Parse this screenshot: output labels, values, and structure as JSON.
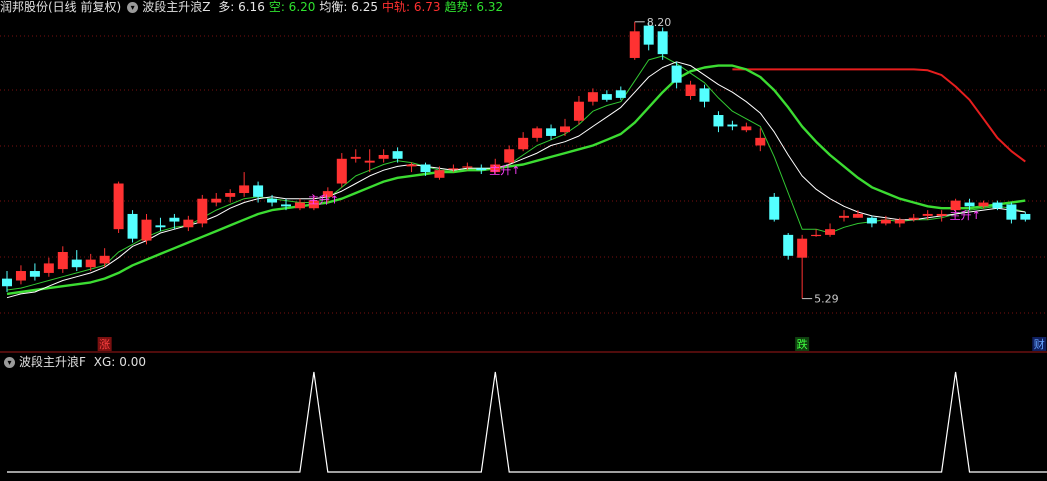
{
  "main_header": {
    "stock": "润邦股份(日线 前复权)",
    "indicator": "波段主升浪Z",
    "items": [
      {
        "label": "多:",
        "value": "6.16",
        "color": "#e6e6e6"
      },
      {
        "label": "空:",
        "value": "6.20",
        "color": "#2fe12f"
      },
      {
        "label": "均衡:",
        "value": "6.25",
        "color": "#e6e6e6"
      },
      {
        "label": "中轨:",
        "value": "6.73",
        "color": "#ff3030"
      },
      {
        "label": "趋势:",
        "value": "6.32",
        "color": "#2fe12f"
      }
    ]
  },
  "sub_header": {
    "indicator": "波段主升浪F",
    "label": "XG:",
    "value": "0.00"
  },
  "icons": {
    "dropdown": "chevron-down-icon"
  },
  "colors": {
    "up": "#ff3232",
    "down": "#54ffff",
    "trend": "#3cdc32",
    "duo": "#ffffff",
    "kong": "#32c832",
    "zhonggui": "#e61e1e",
    "signal": "#ff40ff",
    "grid": "#7a1010"
  },
  "chart_data": {
    "type": "candlestick",
    "price_axis": {
      "min": 4.96,
      "max": 8.24
    },
    "candles": [
      [
        5.5,
        5.42,
        5.58,
        5.36
      ],
      [
        5.48,
        5.58,
        5.64,
        5.44
      ],
      [
        5.58,
        5.52,
        5.66,
        5.48
      ],
      [
        5.56,
        5.66,
        5.72,
        5.52
      ],
      [
        5.6,
        5.78,
        5.84,
        5.56
      ],
      [
        5.7,
        5.62,
        5.8,
        5.58
      ],
      [
        5.62,
        5.7,
        5.76,
        5.58
      ],
      [
        5.66,
        5.74,
        5.82,
        5.62
      ],
      [
        6.02,
        6.5,
        6.52,
        5.98
      ],
      [
        6.18,
        5.92,
        6.22,
        5.88
      ],
      [
        5.9,
        6.12,
        6.18,
        5.86
      ],
      [
        6.06,
        6.04,
        6.14,
        6.0
      ],
      [
        6.14,
        6.1,
        6.18,
        6.02
      ],
      [
        6.04,
        6.12,
        6.16,
        6.0
      ],
      [
        6.08,
        6.34,
        6.38,
        6.04
      ],
      [
        6.3,
        6.34,
        6.4,
        6.26
      ],
      [
        6.36,
        6.4,
        6.44,
        6.3
      ],
      [
        6.4,
        6.48,
        6.62,
        6.36
      ],
      [
        6.48,
        6.36,
        6.52,
        6.3
      ],
      [
        6.34,
        6.3,
        6.38,
        6.26
      ],
      [
        6.28,
        6.26,
        6.34,
        6.22
      ],
      [
        6.24,
        6.3,
        6.34,
        6.22
      ],
      [
        6.24,
        6.32,
        6.38,
        6.22
      ],
      [
        6.36,
        6.42,
        6.46,
        6.3
      ],
      [
        6.5,
        6.76,
        6.82,
        6.46
      ],
      [
        6.76,
        6.78,
        6.86,
        6.72
      ],
      [
        6.72,
        6.74,
        6.86,
        6.62
      ],
      [
        6.76,
        6.8,
        6.86,
        6.72
      ],
      [
        6.84,
        6.76,
        6.88,
        6.72
      ],
      [
        6.68,
        6.7,
        6.72,
        6.62
      ],
      [
        6.7,
        6.62,
        6.72,
        6.58
      ],
      [
        6.56,
        6.64,
        6.68,
        6.54
      ],
      [
        6.66,
        6.66,
        6.7,
        6.62
      ],
      [
        6.68,
        6.68,
        6.72,
        6.64
      ],
      [
        6.66,
        6.64,
        6.7,
        6.6
      ],
      [
        6.62,
        6.7,
        6.76,
        6.6
      ],
      [
        6.72,
        6.86,
        6.9,
        6.7
      ],
      [
        6.86,
        6.98,
        7.04,
        6.84
      ],
      [
        6.98,
        7.08,
        7.1,
        6.94
      ],
      [
        7.08,
        7.0,
        7.12,
        6.96
      ],
      [
        7.04,
        7.1,
        7.18,
        7.0
      ],
      [
        7.16,
        7.36,
        7.42,
        7.12
      ],
      [
        7.36,
        7.46,
        7.5,
        7.32
      ],
      [
        7.44,
        7.38,
        7.48,
        7.36
      ],
      [
        7.48,
        7.4,
        7.52,
        7.38
      ],
      [
        7.82,
        8.1,
        8.2,
        7.8
      ],
      [
        8.16,
        7.96,
        8.2,
        7.9
      ],
      [
        8.1,
        7.86,
        8.14,
        7.8
      ],
      [
        7.74,
        7.56,
        7.78,
        7.5
      ],
      [
        7.42,
        7.54,
        7.58,
        7.38
      ],
      [
        7.5,
        7.36,
        7.54,
        7.3
      ],
      [
        7.22,
        7.1,
        7.26,
        7.04
      ],
      [
        7.12,
        7.1,
        7.16,
        7.06
      ],
      [
        7.06,
        7.1,
        7.14,
        7.04
      ],
      [
        6.9,
        6.98,
        7.08,
        6.84
      ],
      [
        6.36,
        6.12,
        6.4,
        6.1
      ],
      [
        5.96,
        5.74,
        5.98,
        5.7
      ],
      [
        5.72,
        5.92,
        5.96,
        5.29
      ],
      [
        5.96,
        5.96,
        6.02,
        5.94
      ],
      [
        5.96,
        6.02,
        6.08,
        5.94
      ],
      [
        6.14,
        6.16,
        6.22,
        6.1
      ],
      [
        6.14,
        6.18,
        6.22,
        6.14
      ],
      [
        6.14,
        6.08,
        6.16,
        6.04
      ],
      [
        6.08,
        6.12,
        6.16,
        6.06
      ],
      [
        6.08,
        6.12,
        6.14,
        6.04
      ],
      [
        6.12,
        6.14,
        6.18,
        6.1
      ],
      [
        6.16,
        6.18,
        6.22,
        6.12
      ],
      [
        6.16,
        6.18,
        6.22,
        6.1
      ],
      [
        6.22,
        6.32,
        6.34,
        6.2
      ],
      [
        6.3,
        6.26,
        6.34,
        6.22
      ],
      [
        6.26,
        6.3,
        6.32,
        6.24
      ],
      [
        6.3,
        6.24,
        6.32,
        6.22
      ],
      [
        6.28,
        6.12,
        6.3,
        6.08
      ],
      [
        6.18,
        6.12,
        6.2,
        6.1
      ]
    ],
    "ma_lines": {
      "duo": [
        5.3,
        5.34,
        5.36,
        5.42,
        5.48,
        5.52,
        5.56,
        5.62,
        5.72,
        5.84,
        5.9,
        5.98,
        6.02,
        6.06,
        6.1,
        6.16,
        6.24,
        6.3,
        6.34,
        6.36,
        6.34,
        6.34,
        6.34,
        6.36,
        6.42,
        6.5,
        6.58,
        6.64,
        6.68,
        6.7,
        6.68,
        6.66,
        6.64,
        6.66,
        6.66,
        6.66,
        6.7,
        6.76,
        6.82,
        6.9,
        6.94,
        7.0,
        7.1,
        7.2,
        7.3,
        7.46,
        7.62,
        7.72,
        7.78,
        7.74,
        7.64,
        7.54,
        7.46,
        7.36,
        7.24,
        7.04,
        6.8,
        6.58,
        6.44,
        6.34,
        6.26,
        6.2,
        6.16,
        6.14,
        6.12,
        6.12,
        6.14,
        6.16,
        6.18,
        6.2,
        6.22,
        6.24,
        6.22,
        6.2
      ],
      "kong": [
        5.38,
        5.4,
        5.44,
        5.48,
        5.52,
        5.56,
        5.6,
        5.64,
        5.78,
        5.86,
        5.94,
        6.0,
        6.04,
        6.06,
        6.14,
        6.22,
        6.28,
        6.34,
        6.36,
        6.34,
        6.32,
        6.3,
        6.3,
        6.34,
        6.46,
        6.58,
        6.64,
        6.7,
        6.74,
        6.72,
        6.68,
        6.64,
        6.64,
        6.66,
        6.66,
        6.66,
        6.7,
        6.8,
        6.9,
        6.96,
        7.02,
        7.12,
        7.26,
        7.32,
        7.36,
        7.58,
        7.8,
        7.84,
        7.76,
        7.66,
        7.56,
        7.4,
        7.26,
        7.18,
        7.1,
        6.78,
        6.4,
        6.02,
        6.02,
        5.98,
        6.04,
        6.08,
        6.1,
        6.12,
        6.1,
        6.12,
        6.12,
        6.14,
        6.18,
        6.22,
        6.24,
        6.26,
        6.24,
        6.2
      ],
      "zhonggui": [
        null,
        null,
        null,
        null,
        null,
        null,
        null,
        null,
        null,
        null,
        null,
        null,
        null,
        null,
        null,
        null,
        null,
        null,
        null,
        null,
        null,
        null,
        null,
        null,
        null,
        null,
        null,
        null,
        null,
        null,
        null,
        null,
        null,
        null,
        null,
        null,
        null,
        null,
        null,
        null,
        null,
        null,
        null,
        null,
        null,
        null,
        null,
        null,
        null,
        null,
        null,
        null,
        7.7,
        7.7,
        7.7,
        7.7,
        7.7,
        7.7,
        7.7,
        7.7,
        7.7,
        7.7,
        7.7,
        7.7,
        7.7,
        7.7,
        7.69,
        7.64,
        7.52,
        7.38,
        7.18,
        6.98,
        6.84,
        6.73
      ],
      "trend": [
        5.34,
        5.36,
        5.38,
        5.4,
        5.42,
        5.44,
        5.46,
        5.5,
        5.56,
        5.64,
        5.7,
        5.76,
        5.82,
        5.88,
        5.94,
        6.0,
        6.06,
        6.12,
        6.18,
        6.22,
        6.24,
        6.26,
        6.28,
        6.3,
        6.34,
        6.4,
        6.46,
        6.52,
        6.56,
        6.58,
        6.6,
        6.62,
        6.62,
        6.64,
        6.64,
        6.66,
        6.68,
        6.7,
        6.74,
        6.78,
        6.82,
        6.86,
        6.9,
        6.96,
        7.02,
        7.14,
        7.3,
        7.46,
        7.6,
        7.68,
        7.72,
        7.74,
        7.74,
        7.7,
        7.62,
        7.48,
        7.3,
        7.1,
        6.94,
        6.8,
        6.68,
        6.56,
        6.46,
        6.4,
        6.34,
        6.3,
        6.26,
        6.24,
        6.24,
        6.24,
        6.26,
        6.28,
        6.3,
        6.32
      ]
    },
    "annotations": [
      {
        "text": "8.20",
        "bar": 45,
        "price": 8.2,
        "color": "#c8c8c8"
      },
      {
        "text": "5.29",
        "bar": 57,
        "price": 5.29,
        "color": "#c8c8c8"
      }
    ],
    "signals": [
      {
        "text": "主升↑",
        "bar": 22,
        "price": 6.33
      },
      {
        "text": "主升↑",
        "bar": 35,
        "price": 6.64
      },
      {
        "text": "主升↑",
        "bar": 68,
        "price": 6.17
      }
    ],
    "markers": [
      {
        "text": "涨",
        "bar": 7,
        "color": "#ff4040",
        "bg": "#7a1010"
      },
      {
        "text": "跌",
        "bar": 57,
        "color": "#40ff40",
        "bg": "#104010"
      },
      {
        "text": "财",
        "bar": 74,
        "color": "#66a3ff",
        "bg": "#102060"
      }
    ],
    "sub_series": {
      "name": "XG",
      "values": [
        0,
        0,
        0,
        0,
        0,
        0,
        0,
        0,
        0,
        0,
        0,
        0,
        0,
        0,
        0,
        0,
        0,
        0,
        0,
        0,
        0,
        0,
        1,
        0,
        0,
        0,
        0,
        0,
        0,
        0,
        0,
        0,
        0,
        0,
        0,
        1,
        0,
        0,
        0,
        0,
        0,
        0,
        0,
        0,
        0,
        0,
        0,
        0,
        0,
        0,
        0,
        0,
        0,
        0,
        0,
        0,
        0,
        0,
        0,
        0,
        0,
        0,
        0,
        0,
        0,
        0,
        0,
        0,
        1,
        0,
        0,
        0,
        0,
        0
      ],
      "ylim": [
        0,
        1
      ]
    }
  }
}
